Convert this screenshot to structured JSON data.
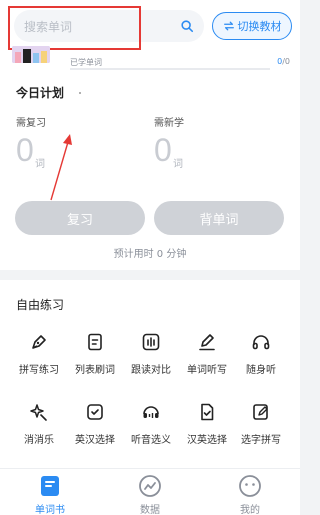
{
  "search": {
    "placeholder": "搜索单词"
  },
  "header": {
    "switch_label": "切换教材"
  },
  "book": {
    "learned_label": "已学单词",
    "learned": "0",
    "total": "/0",
    "progress": 0
  },
  "plan": {
    "title": "今日计划",
    "review_label": "需复习",
    "review_count": "0",
    "review_unit": "词",
    "new_label": "需新学",
    "new_count": "0",
    "new_unit": "词",
    "review_button": "复习",
    "learn_button": "背单词",
    "estimate": "预计用时 0 分钟"
  },
  "practice": {
    "title": "自由练习",
    "items": [
      {
        "label": "拼写练习",
        "icon": "pen-nib-icon"
      },
      {
        "label": "列表刷词",
        "icon": "list-doc-icon"
      },
      {
        "label": "跟读对比",
        "icon": "soundwave-icon"
      },
      {
        "label": "单词听写",
        "icon": "edit-pencil-icon"
      },
      {
        "label": "随身听",
        "icon": "headphones-icon"
      },
      {
        "label": "消消乐",
        "icon": "sparkle-icon"
      },
      {
        "label": "英汉选择",
        "icon": "check-doc-icon"
      },
      {
        "label": "听音选义",
        "icon": "headset-icon"
      },
      {
        "label": "汉英选择",
        "icon": "doc-check-icon"
      },
      {
        "label": "选字拼写",
        "icon": "doc-write-icon"
      }
    ]
  },
  "tabs": [
    {
      "label": "单词书",
      "icon": "book-icon",
      "active": true
    },
    {
      "label": "数据",
      "icon": "chart-circle-icon",
      "active": false
    },
    {
      "label": "我的",
      "icon": "smile-face-icon",
      "active": false
    }
  ],
  "colors": {
    "accent": "#2b8bf2",
    "disabled": "#cfd2d7",
    "annotation": "#e53935"
  }
}
